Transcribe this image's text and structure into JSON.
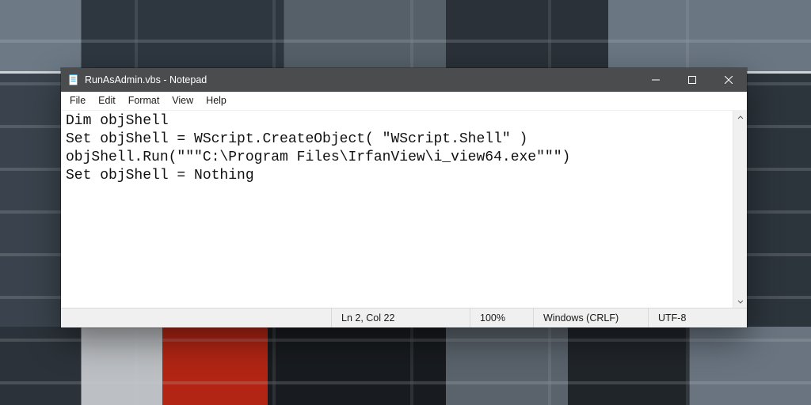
{
  "window": {
    "title": "RunAsAdmin.vbs - Notepad"
  },
  "menu": {
    "file": "File",
    "edit": "Edit",
    "format": "Format",
    "view": "View",
    "help": "Help"
  },
  "editor": {
    "content": "Dim objShell\nSet objShell = WScript.CreateObject( \"WScript.Shell\" )\nobjShell.Run(\"\"\"C:\\Program Files\\IrfanView\\i_view64.exe\"\"\")\nSet objShell = Nothing"
  },
  "status": {
    "position": "Ln 2, Col 22",
    "zoom": "100%",
    "line_ending": "Windows (CRLF)",
    "encoding": "UTF-8"
  },
  "colors": {
    "titlebar_bg": "#4b4c4d",
    "window_bg": "#ffffff",
    "statusbar_bg": "#f0f0f0"
  }
}
